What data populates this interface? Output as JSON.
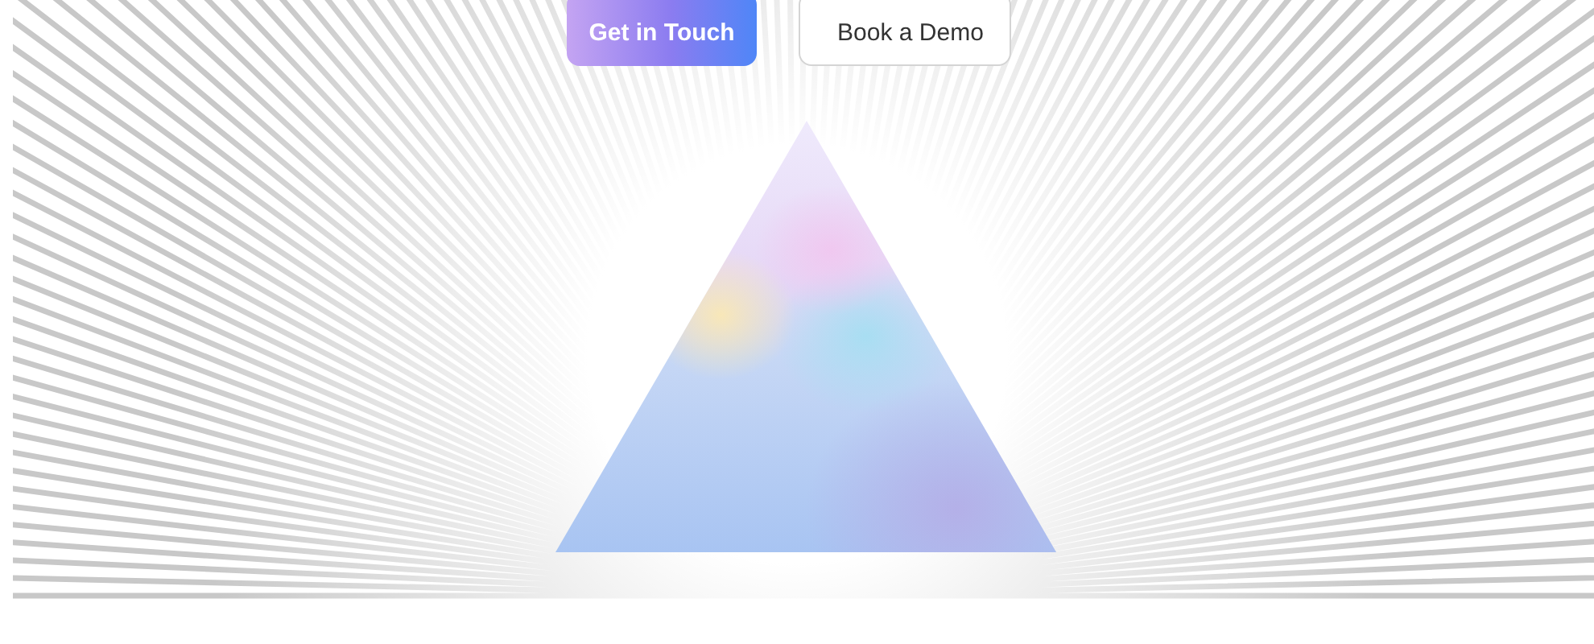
{
  "buttons": [
    {
      "label": "Get in Touch",
      "kind": "primary"
    },
    {
      "label": "Book a Demo",
      "kind": "secondary"
    }
  ]
}
